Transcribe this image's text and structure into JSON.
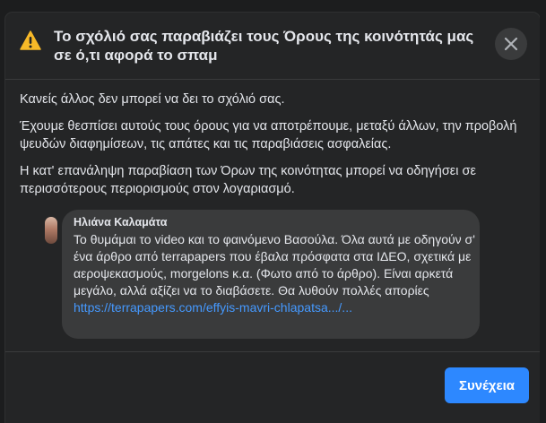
{
  "dialog": {
    "title": "Το σχόλιό σας παραβιάζει τους Όρους της κοινότητάς μας σε ό,τι αφορά το σπαμ",
    "icons": {
      "warning": "warning-icon",
      "close": "close-icon"
    },
    "paragraphs": [
      "Κανείς άλλος δεν μπορεί να δει το σχόλιό σας.",
      "Έχουμε θεσπίσει αυτούς τους όρους για να αποτρέπουμε, μεταξύ άλλων, την προβολή ψευδών διαφημίσεων, τις απάτες και τις παραβιάσεις ασφαλείας.",
      "Η κατ' επανάληψη παραβίαση των Όρων της κοινότητας μπορεί να οδηγήσει σε περισσότερους περιορισμούς στον λογαριασμό."
    ],
    "comment": {
      "author": "Ηλιάνα Καλαμάτα",
      "text": "Το θυμάμαι το video και το φαινόμενο Βασούλα. Όλα αυτά με οδηγούν σ' ένα άρθρο από terrapapers που έβαλα πρόσφατα στα ΙΔΕΟ, σχετικά με αεροψεκασμούς, morgelons κ.α. (Φωτο από το άρθρο). Είναι αρκετά μεγάλο, αλλά αξίζει να το διαβάσετε. Θα λυθούν πολλές απορίες",
      "link": "https://terrapapers.com/effyis-mavri-chlapatsa.../..."
    },
    "continue_label": "Συνέχεια"
  },
  "colors": {
    "background": "#242526",
    "bubble": "#3a3b3c",
    "accent": "#2d88ff",
    "warning": "#f7b928",
    "link": "#4599ff"
  }
}
